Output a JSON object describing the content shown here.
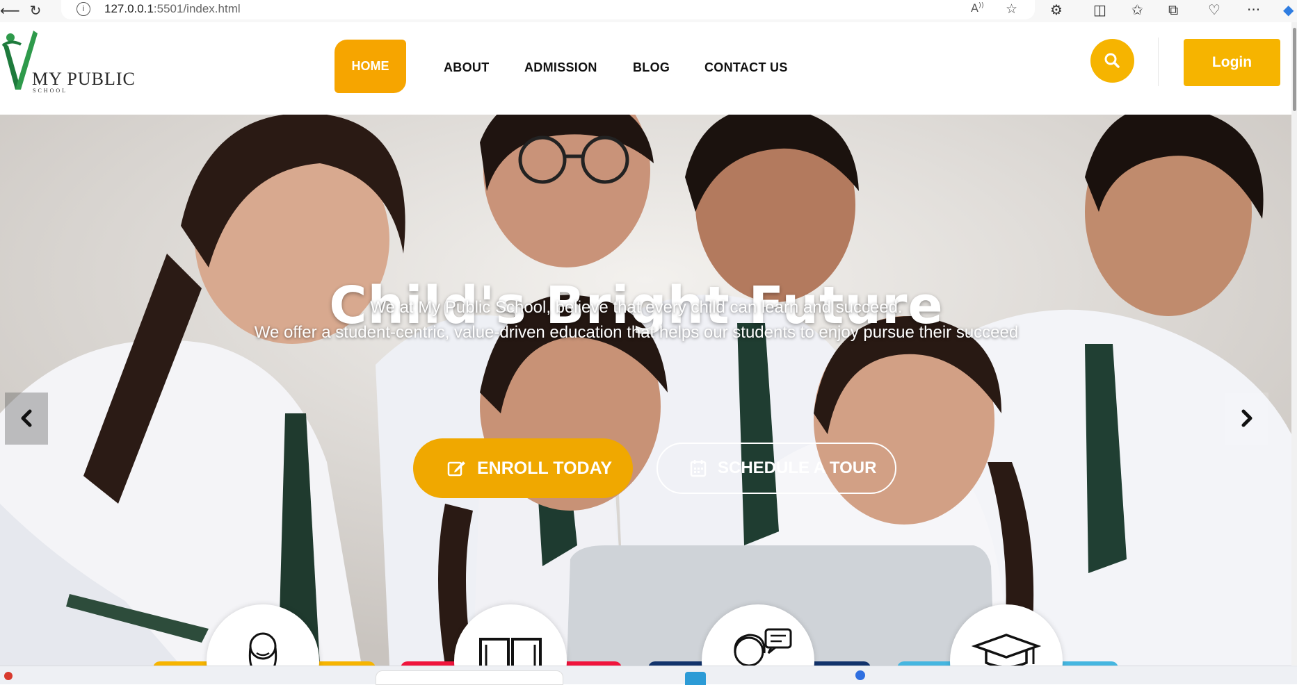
{
  "browser": {
    "url_host": "127.0.0.1",
    "url_rest": ":5501/index.html",
    "icons": [
      "back-icon",
      "reload-icon",
      "info-icon",
      "read-aloud-icon",
      "favorite-star-icon",
      "extensions-icon",
      "split-screen-icon",
      "favorites-icon",
      "collections-icon",
      "browser-essentials-icon",
      "more-icon",
      "copilot-icon"
    ]
  },
  "site": {
    "logo": {
      "title": "MY PUBLIC",
      "subtitle": "SCHOOL"
    },
    "nav": [
      {
        "label": "HOME",
        "active": true
      },
      {
        "label": "ABOUT",
        "active": false
      },
      {
        "label": "ADMISSION",
        "active": false
      },
      {
        "label": "BLOG",
        "active": false
      },
      {
        "label": "CONTACT US",
        "active": false
      }
    ],
    "login_label": "Login",
    "colors": {
      "accent": "#f6a500",
      "logo_green": "#1e7a3c"
    }
  },
  "hero": {
    "title": "Child's Bright Future",
    "line1": "We at My Public School, believe that every child can learn and succeed.",
    "line2": "We offer a student-centric, value-driven education that helps our students to enjoy pursue their succeed",
    "enroll_label": "ENROLL TODAY",
    "tour_label": "SCHEDULE A TOUR"
  },
  "features": [
    {
      "icon": "teacher-icon",
      "bar_color": "#f6b400"
    },
    {
      "icon": "book-icon",
      "bar_color": "#f0143c"
    },
    {
      "icon": "counselor-chat-icon",
      "bar_color": "#12336b"
    },
    {
      "icon": "graduation-cap-icon",
      "bar_color": "#45b6e0"
    }
  ]
}
